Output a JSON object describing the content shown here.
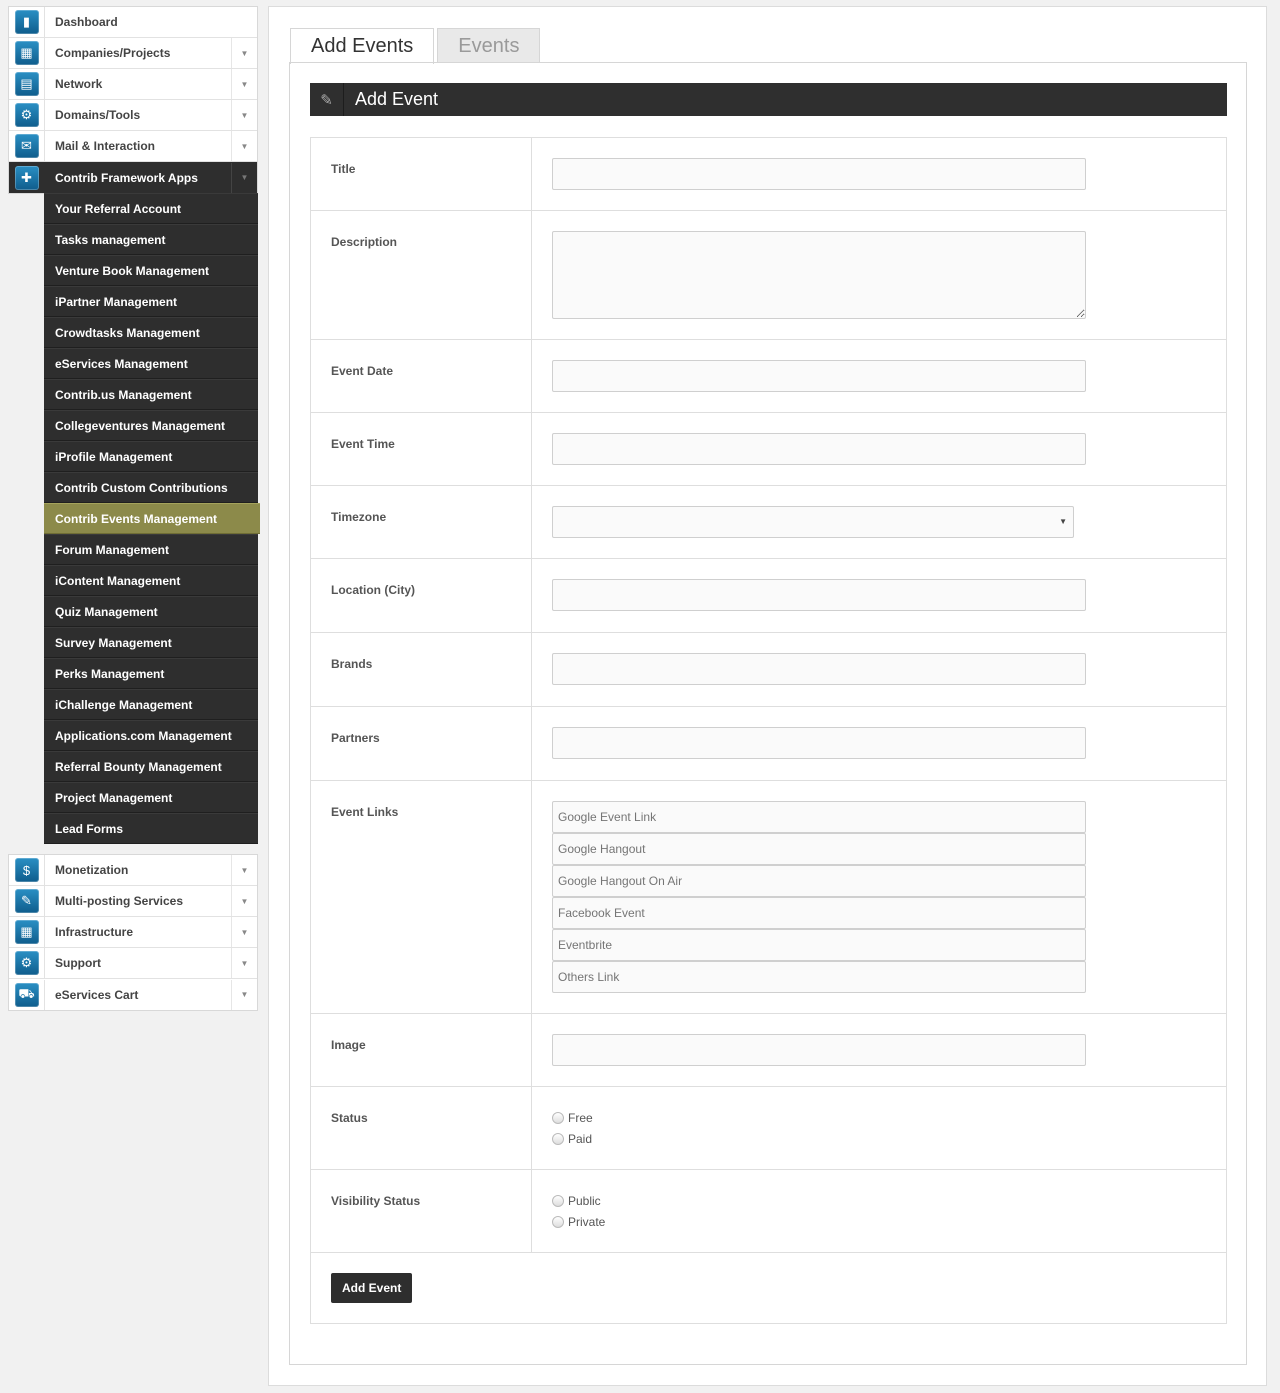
{
  "sidebar": {
    "top_items": [
      {
        "label": "Dashboard",
        "icon": "chart-icon",
        "glyph": "▮",
        "has_arrow": false
      },
      {
        "label": "Companies/Projects",
        "icon": "building-icon",
        "glyph": "▦",
        "has_arrow": true
      },
      {
        "label": "Network",
        "icon": "network-icon",
        "glyph": "▤",
        "has_arrow": true
      },
      {
        "label": "Domains/Tools",
        "icon": "gear-icon",
        "glyph": "⚙",
        "has_arrow": true
      },
      {
        "label": "Mail & Interaction",
        "icon": "mail-icon",
        "glyph": "✉",
        "has_arrow": true
      }
    ],
    "active_item": {
      "label": "Contrib Framework Apps",
      "icon": "puzzle-icon",
      "glyph": "✚"
    },
    "sub_items": [
      "Your Referral Account",
      "Tasks management",
      "Venture Book Management",
      "iPartner Management",
      "Crowdtasks Management",
      "eServices Management",
      "Contrib.us Management",
      "Collegeventures Management",
      "iProfile Management",
      "Contrib Custom Contributions",
      "Contrib Events Management",
      "Forum Management",
      "iContent Management",
      "Quiz Management",
      "Survey Management",
      "Perks Management",
      "iChallenge Management",
      "Applications.com Management",
      "Referral Bounty Management",
      "Project Management",
      "Lead Forms"
    ],
    "selected_sub_index": 10,
    "bottom_items": [
      {
        "label": "Monetization",
        "icon": "money-icon",
        "glyph": "$"
      },
      {
        "label": "Multi-posting Services",
        "icon": "brush-icon",
        "glyph": "✎"
      },
      {
        "label": "Infrastructure",
        "icon": "grid-icon",
        "glyph": "▦"
      },
      {
        "label": "Support",
        "icon": "support-gear-icon",
        "glyph": "⚙"
      },
      {
        "label": "eServices Cart",
        "icon": "cart-icon",
        "glyph": "⛟"
      }
    ]
  },
  "tabs": [
    {
      "label": "Add Events",
      "active": true
    },
    {
      "label": "Events",
      "active": false
    }
  ],
  "panel": {
    "title": "Add Event"
  },
  "form": {
    "title_label": "Title",
    "description_label": "Description",
    "event_date_label": "Event Date",
    "event_time_label": "Event Time",
    "timezone_label": "Timezone",
    "location_label": "Location (City)",
    "brands_label": "Brands",
    "partners_label": "Partners",
    "event_links_label": "Event Links",
    "event_links_placeholders": {
      "google_event": "Google Event Link",
      "google_hangout": "Google Hangout",
      "google_hangout_on_air": "Google Hangout On Air",
      "facebook_event": "Facebook Event",
      "eventbrite": "Eventbrite",
      "others": "Others Link"
    },
    "image_label": "Image",
    "status_label": "Status",
    "status_options": [
      "Free",
      "Paid"
    ],
    "visibility_label": "Visibility Status",
    "visibility_options": [
      "Public",
      "Private"
    ],
    "submit_label": "Add Event"
  }
}
